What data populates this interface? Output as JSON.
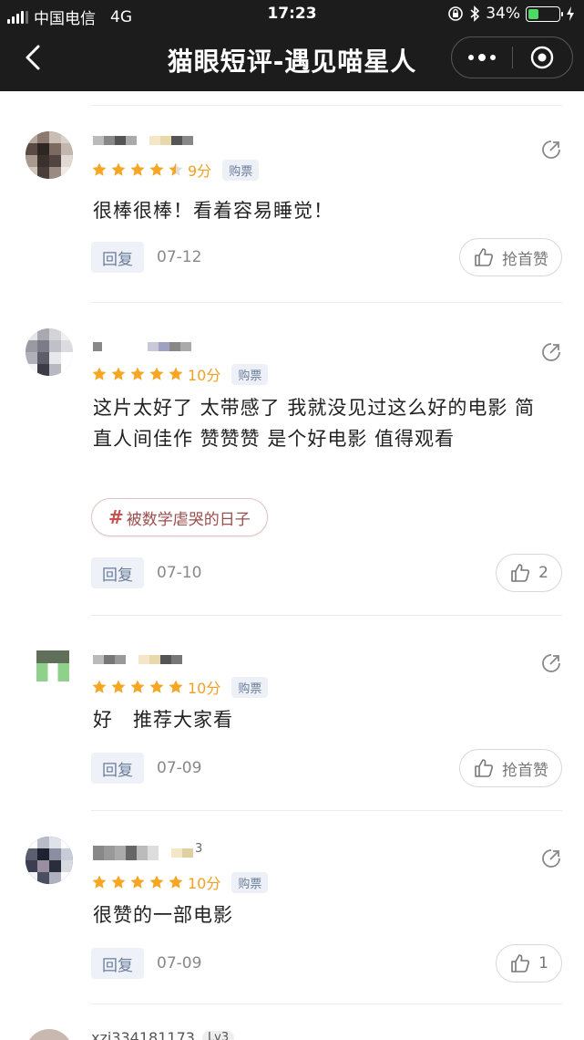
{
  "status_bar": {
    "carrier": "中国电信",
    "network": "4G",
    "time": "17:23",
    "battery": "34%",
    "battery_level": 0.34
  },
  "nav": {
    "title": "猫眼短评-遇见喵星人"
  },
  "badge_buy": "购票",
  "reviews": [
    {
      "score": "9分",
      "text": "很棒很棒！看着容易睡觉！",
      "reply": "回复",
      "date": "07-12",
      "like_label": "抢首赞",
      "stars": 4.5
    },
    {
      "score": "10分",
      "text": "这片太好了 太带感了 我就没见过这么好的电影 简直人间佳作 赞赞赞 是个好电影 值得观看",
      "tag": "被数学虐哭的日子",
      "reply": "回复",
      "date": "07-10",
      "like_label": "2",
      "stars": 5
    },
    {
      "score": "10分",
      "text": "好　推荐大家看",
      "reply": "回复",
      "date": "07-09",
      "like_label": "抢首赞",
      "stars": 5
    },
    {
      "score": "10分",
      "level": "3",
      "text": "很赞的一部电影",
      "reply": "回复",
      "date": "07-09",
      "like_label": "1",
      "stars": 5
    }
  ],
  "next_user": {
    "name": "xzj334181173",
    "level": "Lv3"
  },
  "colors": {
    "star": "#f5a623",
    "header": "#1c1c1c"
  }
}
